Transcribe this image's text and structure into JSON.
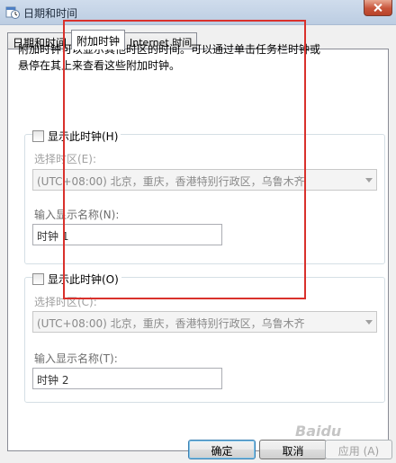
{
  "window": {
    "title": "日期和时间",
    "title_icon": "clock-calendar-icon",
    "close_icon": "close-icon"
  },
  "tabs": [
    {
      "label": "日期和时间",
      "active": false
    },
    {
      "label": "附加时钟",
      "active": true
    },
    {
      "label": "Internet 时间",
      "active": false
    }
  ],
  "description": "附加时钟可以显示其他时区的时间。可以通过单击任务栏时钟或悬停在其上来查看这些附加时钟。",
  "clock1": {
    "show_label": "显示此时钟(H)",
    "checked": false,
    "timezone_label": "选择时区(E):",
    "timezone_value": "(UTC+08:00) 北京，重庆，香港特别行政区，乌鲁木齐",
    "name_label": "输入显示名称(N):",
    "name_value": "时钟 1"
  },
  "clock2": {
    "show_label": "显示此时钟(O)",
    "checked": false,
    "timezone_label": "选择时区(C):",
    "timezone_value": "(UTC+08:00) 北京，重庆，香港特别行政区，乌鲁木齐",
    "name_label": "输入显示名称(T):",
    "name_value": "时钟 2"
  },
  "buttons": {
    "ok": "确定",
    "cancel": "取消",
    "apply": "应用 (A)"
  },
  "watermark": "Baidu",
  "highlight_color": "#d9312c"
}
